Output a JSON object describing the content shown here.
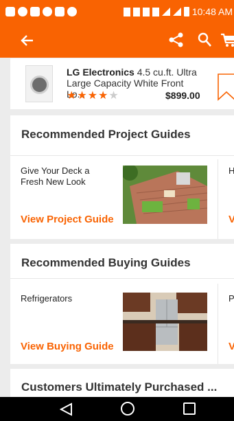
{
  "status_bar": {
    "time": "10:48 AM"
  },
  "toolbar": {
    "back_icon": "arrow-back-icon",
    "share_icon": "share-icon",
    "search_icon": "search-icon",
    "cart_icon": "cart-icon"
  },
  "product": {
    "brand": "LG Electronics",
    "title": "4.5 cu.ft. Ultra Large Capacity White Front Lo...",
    "price": "$899.00",
    "rating_stars": 3.5
  },
  "project_guides": {
    "heading": "Recommended Project Guides",
    "items": [
      {
        "title": "Give Your Deck a Fresh New Look",
        "link": "View Project Guide"
      },
      {
        "title": "How to Build a Deck",
        "link": "View Project Guide"
      }
    ]
  },
  "buying_guides": {
    "heading": "Recommended Buying Guides",
    "items": [
      {
        "title": "Refrigerators",
        "link": "View Buying Guide"
      },
      {
        "title": "Patio Furniture Buying Guide",
        "link": "View Buying Guide"
      }
    ]
  },
  "customers_purchased": {
    "heading": "Customers Ultimately Purchased ..."
  },
  "colors": {
    "accent": "#f96302"
  }
}
